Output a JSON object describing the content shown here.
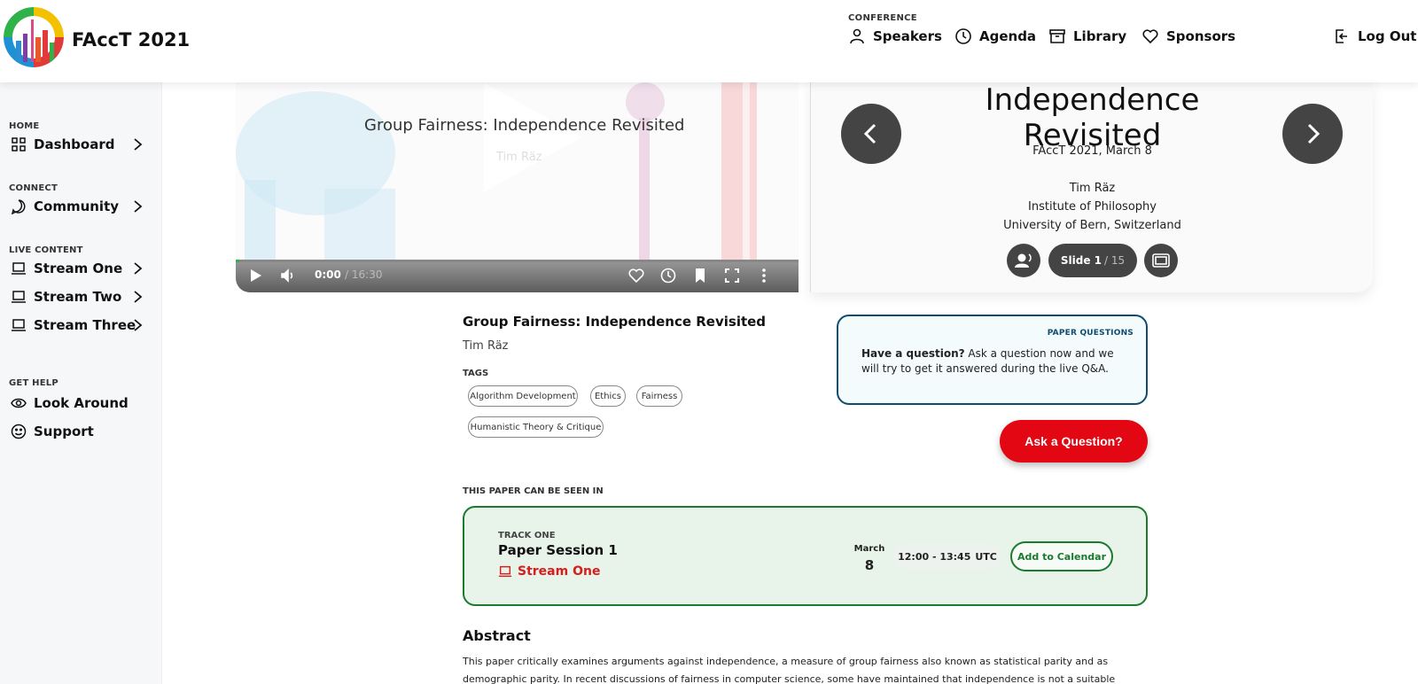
{
  "header": {
    "brand": "FAccT 2021",
    "section_label": "CONFERENCE",
    "nav": [
      {
        "label": "Speakers",
        "icon": "person-icon"
      },
      {
        "label": "Agenda",
        "icon": "clock-icon"
      },
      {
        "label": "Library",
        "icon": "archive-icon"
      },
      {
        "label": "Sponsors",
        "icon": "heart-icon"
      }
    ],
    "logout_label": "Log Out"
  },
  "sidebar": {
    "sections": [
      {
        "label": "HOME",
        "items": [
          {
            "label": "Dashboard",
            "icon": "grid-icon"
          }
        ]
      },
      {
        "label": "CONNECT",
        "items": [
          {
            "label": "Community",
            "icon": "chat-icon"
          }
        ]
      },
      {
        "label": "LIVE CONTENT",
        "items": [
          {
            "label": "Stream One",
            "icon": "laptop-icon"
          },
          {
            "label": "Stream Two",
            "icon": "laptop-icon"
          },
          {
            "label": "Stream Three",
            "icon": "laptop-icon"
          }
        ]
      },
      {
        "label": "GET HELP",
        "items": [
          {
            "label": "Look Around",
            "icon": "eye-icon"
          },
          {
            "label": "Support",
            "icon": "smile-icon"
          }
        ]
      }
    ]
  },
  "video": {
    "title": "Group Fairness: Independence Revisited",
    "author": "Tim Räz",
    "current_time": "0:00",
    "duration": "16:30",
    "progress": 0
  },
  "slides": {
    "title": "Independence Revisited",
    "subtitle": "FAccT 2021, March 8",
    "author": "Tim Räz",
    "institute": "Institute of Philosophy",
    "university": "University of Bern, Switzerland",
    "slide_label": "Slide 1",
    "slide_total": "/ 15"
  },
  "paper": {
    "title": "Group Fairness: Independence Revisited",
    "author": "Tim Räz",
    "tags_label": "TAGS",
    "tags": [
      "Algorithm Development",
      "Ethics",
      "Fairness",
      "Humanistic Theory & Critique"
    ]
  },
  "question": {
    "label": "PAPER QUESTIONS",
    "lead": "Have a question?",
    "text": " Ask a question now and we will try to get it answered during the live Q&A.",
    "button": "Ask a Question?"
  },
  "session": {
    "seen_label": "THIS PAPER CAN BE SEEN IN",
    "track": "TRACK ONE",
    "name": "Paper Session 1",
    "stream": "Stream One",
    "month": "March",
    "day": "8",
    "time": "12:00 - 13:45",
    "tz": "UTC",
    "calendar_button": "Add to Calendar"
  },
  "abstract": {
    "heading": "Abstract",
    "text": "This paper critically examines arguments against independence, a measure of group fairness also known as statistical parity and as demographic parity. In recent discussions of fairness in computer science, some have maintained that independence is not a suitable measure of group fairness."
  },
  "colors": {
    "accent_red": "#e30613",
    "session_green": "#1b7a2e",
    "question_blue": "#0f4c6e"
  }
}
